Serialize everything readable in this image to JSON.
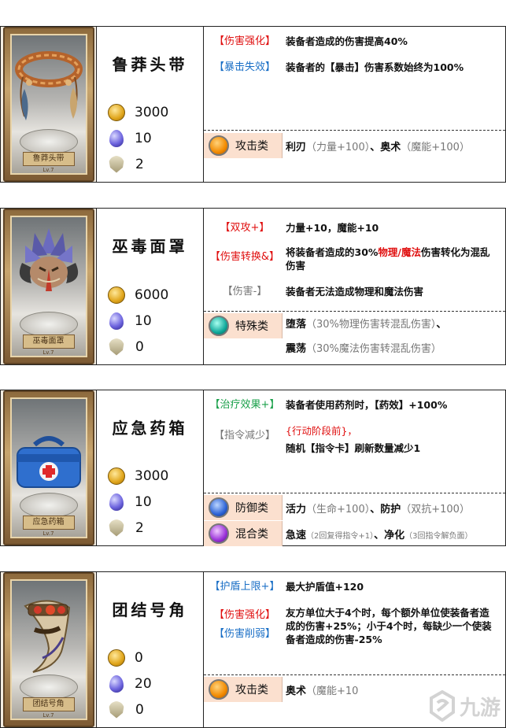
{
  "items": [
    {
      "name": "鲁莽头带",
      "card_label": "鲁莽头带",
      "card_level": "Lv.7",
      "costs": [
        "3000",
        "10",
        "2"
      ],
      "effects": [
        {
          "tag": "【伤害强化】",
          "text": "装备者造成的伤害提高40%"
        },
        {
          "tag": "【暴击失效】",
          "text": "装备者的【暴击】伤害系数始终为100%"
        }
      ],
      "classes": [
        {
          "name": "攻击类",
          "lines": [
            {
              "a": "利刃",
              "b": "（力量+100）",
              "c": "、奥术",
              "d": "（魔能+100）"
            }
          ]
        }
      ]
    },
    {
      "name": "巫毒面罩",
      "card_label": "巫毒面罩",
      "card_level": "Lv.7",
      "costs": [
        "6000",
        "10",
        "0"
      ],
      "effects": [
        {
          "tag": "【双攻+】",
          "text": "力量+10，魔能+10"
        },
        {
          "tag": "【伤害转换&】",
          "text_pre": "将装备者造成的30%",
          "text_red": "物理/魔法",
          "text_post": "伤害转化为混乱伤害"
        },
        {
          "tag": "【伤害-】",
          "text": "装备者无法造成物理和魔法伤害"
        }
      ],
      "classes": [
        {
          "name": "特殊类",
          "lines": [
            {
              "a": "堕落",
              "b": "（30%物理伤害转混乱伤害）",
              "c": "、",
              "d": ""
            },
            {
              "a": "震荡",
              "b": "（30%魔法伤害转混乱伤害）",
              "c": "",
              "d": ""
            }
          ]
        }
      ]
    },
    {
      "name": "应急药箱",
      "card_label": "应急药箱",
      "card_level": "Lv.7",
      "costs": [
        "3000",
        "10",
        "2"
      ],
      "effects": [
        {
          "tag": "【治疗效果+】",
          "text": "装备者使用药剂时，【药效】+100%"
        },
        {
          "tag": "【指令减少】",
          "text_red": "{行动阶段前}，",
          "text": "随机【指令卡】刷新数量减少1"
        }
      ],
      "classes": [
        {
          "name": "防御类",
          "lines": [
            {
              "a": "活力",
              "b": "（生命+100）",
              "c": "、防护",
              "d": "（双抗+100）"
            }
          ]
        },
        {
          "name": "混合类",
          "lines": [
            {
              "a": "急速",
              "b": "（2回复得指令+1）",
              "c": "、净化",
              "d": "（3回指令解负面）"
            }
          ]
        }
      ]
    },
    {
      "name": "团结号角",
      "card_label": "团结号角",
      "card_level": "Lv.7",
      "costs": [
        "0",
        "20",
        "0"
      ],
      "effects": [
        {
          "tag": "【护盾上限+】",
          "text": "最大护盾值+120"
        },
        {
          "tag": "【伤害强化】",
          "tag2": "【伤害削弱】",
          "text": "友方单位大于4个时，每个额外单位使装备者造成的伤害+25%；小于4个时，每缺少一个使装备者造成的伤害-25%"
        }
      ],
      "classes": [
        {
          "name": "攻击类",
          "lines": [
            {
              "a": "奥术",
              "b": "（魔能+10",
              "c": "",
              "d": ""
            }
          ]
        }
      ]
    }
  ],
  "watermark": "九游",
  "colors": {
    "red": "#e01010",
    "blue": "#1a6fc6",
    "green": "#1aa04a",
    "gray": "#777777",
    "class_bg": "#fbe0cf"
  }
}
